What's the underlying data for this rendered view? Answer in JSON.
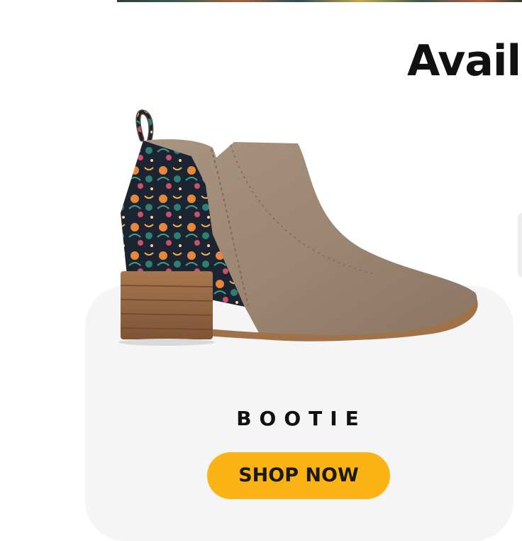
{
  "section": {
    "heading": "Availa"
  },
  "product": {
    "name": "BOOTIE",
    "image_label": "bootie-image",
    "cta_label": "SHOP NOW"
  },
  "colors": {
    "cta_background": "#fbb316",
    "card_background": "#f5f5f5",
    "heading_text": "#111111"
  }
}
